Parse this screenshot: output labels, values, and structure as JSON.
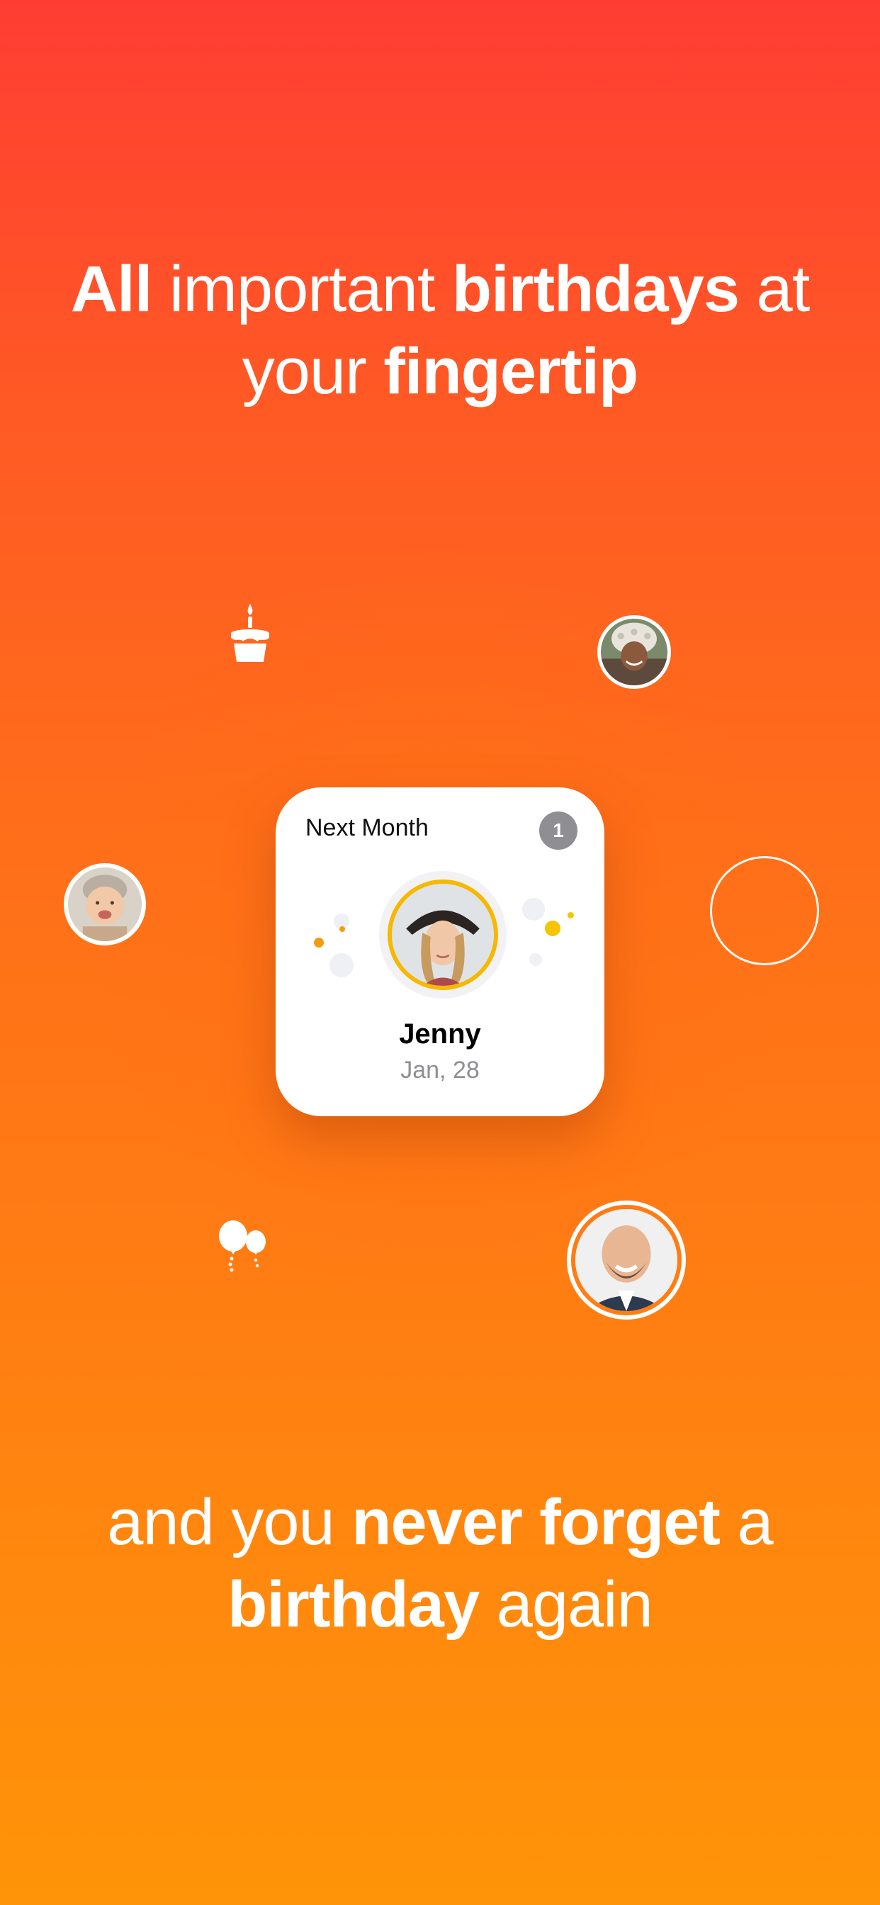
{
  "headline_top": {
    "line1": [
      {
        "text": "All ",
        "bold": true
      },
      {
        "text": "important ",
        "bold": false
      },
      {
        "text": "birthdays",
        "bold": true
      },
      {
        "text": " at",
        "bold": false
      }
    ],
    "line2": [
      {
        "text": "your ",
        "bold": false
      },
      {
        "text": "fingertip",
        "bold": true
      }
    ]
  },
  "widget": {
    "title": "Next Month",
    "badge_count": "1",
    "person_name": "Jenny",
    "person_date": "Jan, 28",
    "accent_ring_color": "#f6b800"
  },
  "headline_bottom": {
    "line1": [
      {
        "text": "and you ",
        "bold": false
      },
      {
        "text": "never forget",
        "bold": true
      },
      {
        "text": " a",
        "bold": false
      }
    ],
    "line2": [
      {
        "text": "birthday",
        "bold": true
      },
      {
        "text": " again",
        "bold": false
      }
    ]
  },
  "icons": {
    "cake": "cake-icon",
    "balloons": "balloons-icon"
  },
  "colors": {
    "gradient_top": "#ff3d33",
    "gradient_bottom": "#ff9408",
    "badge_gray": "#8e8e93"
  }
}
